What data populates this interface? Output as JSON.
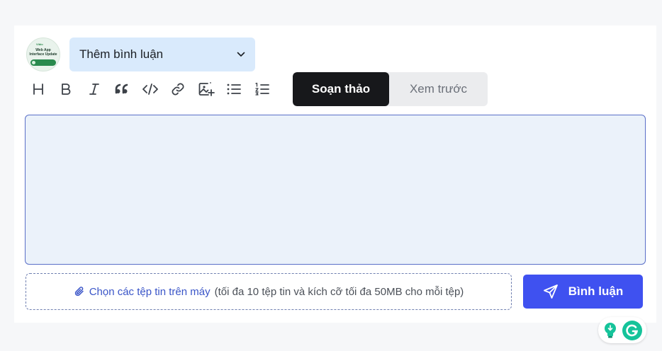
{
  "avatar": {
    "icon": "newsletter-thumbnail",
    "brand": "Viblo",
    "line1": "Web App",
    "line2": "Interface Update"
  },
  "dropdown": {
    "label": "Thêm bình luận",
    "icon": "chevron-down-icon"
  },
  "toolbar": {
    "items": [
      {
        "name": "heading-icon"
      },
      {
        "name": "bold-icon"
      },
      {
        "name": "italic-icon"
      },
      {
        "name": "quote-icon"
      },
      {
        "name": "code-icon"
      },
      {
        "name": "link-icon"
      },
      {
        "name": "image-add-icon"
      },
      {
        "name": "bullet-list-icon"
      },
      {
        "name": "numbered-list-icon"
      }
    ]
  },
  "tabs": {
    "compose": "Soạn thảo",
    "preview": "Xem trước",
    "active": "compose"
  },
  "editor": {
    "value": "",
    "placeholder": ""
  },
  "attachment": {
    "link": "Chọn các tệp tin trên máy",
    "hint": "(tối đa 10 tệp tin và kích cỡ tối đa 50MB cho mỗi tệp)",
    "icon": "paperclip-icon"
  },
  "submit": {
    "label": "Bình luận",
    "icon": "send-icon"
  },
  "colors": {
    "accent": "#3f51f0",
    "dropdown_bg": "#d9eafc",
    "editor_bg": "#ebf2fa",
    "tab_active": "#17181b",
    "grammarly": "#15c39a"
  }
}
